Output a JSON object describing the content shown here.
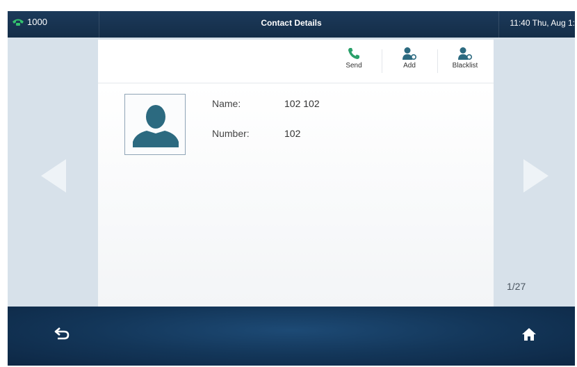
{
  "statusbar": {
    "line_number": "1000",
    "title": "Contact Details",
    "clock": "11:40 Thu, Aug 1:"
  },
  "toolbar": {
    "send_label": "Send",
    "add_label": "Add",
    "blacklist_label": "Blacklist"
  },
  "contact": {
    "name_label": "Name:",
    "name_value": "102 102",
    "number_label": "Number:",
    "number_value": "102"
  },
  "pagination": {
    "indicator": "1/27"
  },
  "icons": {
    "line_status": "phone-handset-icon",
    "send": "phone-icon",
    "add": "add-contact-icon",
    "blacklist": "blacklist-contact-icon",
    "prev": "left-arrow-icon",
    "next": "right-arrow-icon",
    "back": "back-icon",
    "home": "home-icon"
  },
  "colors": {
    "status_bar": "#142d48",
    "content_bg": "#d7e1ea",
    "accent_teal": "#2c6a80",
    "send_green": "#2aa06a"
  }
}
